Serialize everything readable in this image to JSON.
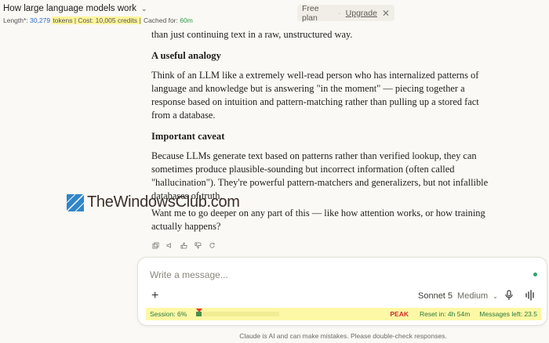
{
  "header": {
    "title": "How large language models work",
    "stats": {
      "length_label": "Length*:",
      "length_value": "30,279",
      "tokens_cost": "tokens | Cost: 10,005 credits |",
      "cached_label": "Cached for:",
      "cached_value": "60m"
    }
  },
  "plan": {
    "label": "Free plan",
    "upgrade": "Upgrade"
  },
  "message": {
    "intro_tail": "than just continuing text in a raw, unstructured way.",
    "analogy_heading": "A useful analogy",
    "analogy_text": "Think of an LLM like a extremely well-read person who has internalized patterns of language and knowledge but is answering \"in the moment\" — piecing together a response based on intuition and pattern-matching rather than pulling up a stored fact from a database.",
    "caveat_heading": "Important caveat",
    "caveat_text": "Because LLMs generate text based on patterns rather than verified lookup, they can sometimes produce plausible-sounding but incorrect information (often called \"hallucination\"). They're powerful pattern-matchers and generalizers, but not infallible databases of truth.",
    "followup": "Want me to go deeper on any part of this — like how attention works, or how training actually happens?"
  },
  "watermark": {
    "text": "TheWindowsClub.com"
  },
  "composer": {
    "placeholder": "Write a message...",
    "model_name": "Sonnet 5",
    "model_mode": "Medium",
    "usage": {
      "session_label": "Session: 6%",
      "session_fraction": 0.06,
      "peak": "PEAK",
      "reset": "Reset in: 4h 54m",
      "messages_left": "Messages left: 23.5"
    }
  },
  "footer": {
    "disclaimer": "Claude is AI and can make mistakes. Please double-check responses."
  },
  "icons": [
    "chevron-down-icon",
    "close-icon",
    "copy-icon",
    "speaker-icon",
    "thumbs-up-icon",
    "thumbs-down-icon",
    "retry-icon",
    "plus-icon",
    "microphone-icon",
    "voice-wave-icon"
  ],
  "colors": {
    "highlight": "#fff59d",
    "peak": "#d12b2b",
    "usage_green": "#2b7a3c",
    "stat_blue": "#2d6bc9"
  }
}
